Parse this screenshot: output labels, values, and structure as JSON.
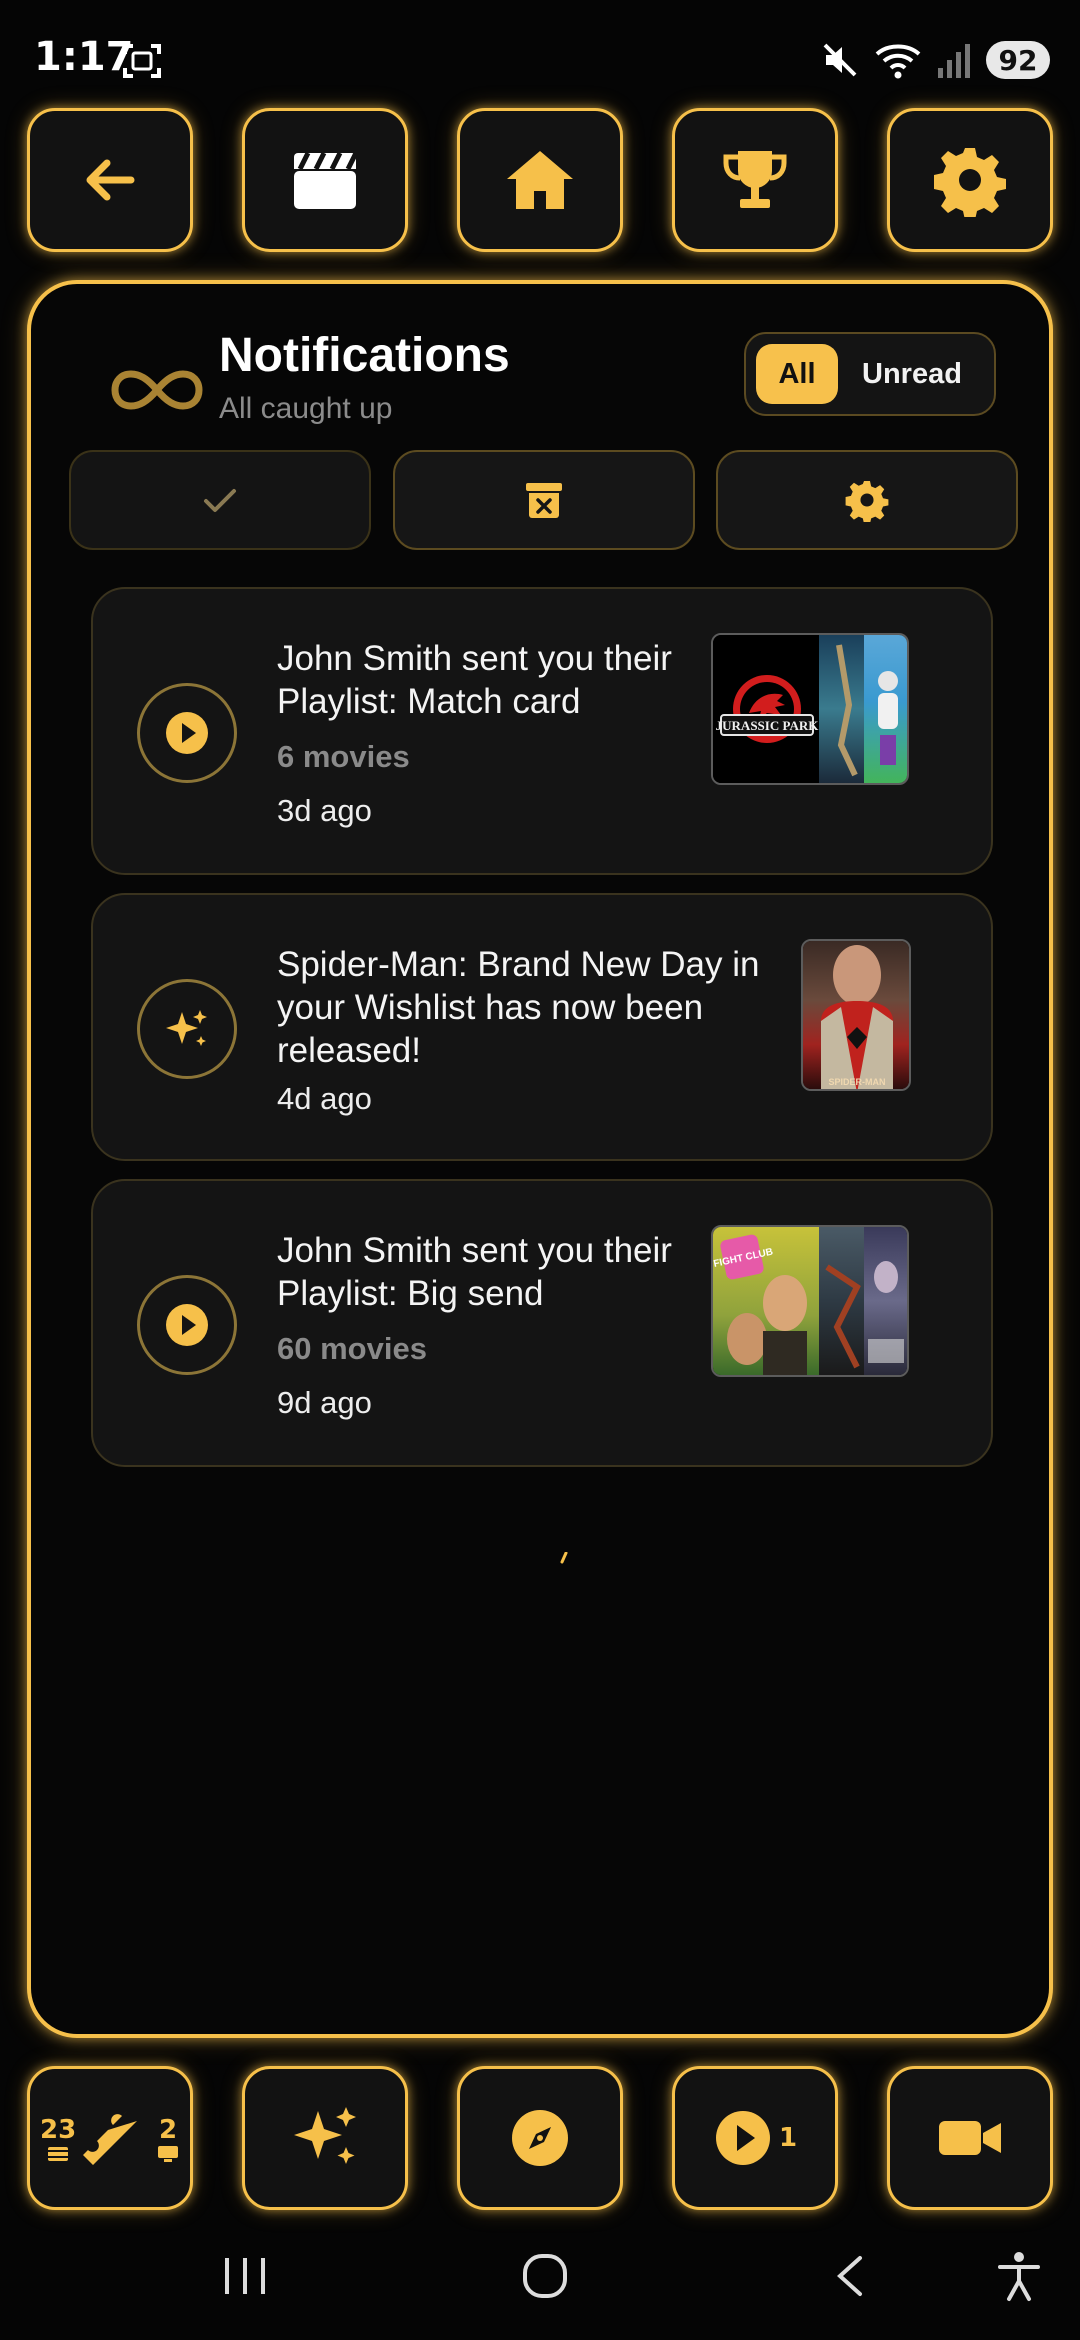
{
  "status_bar": {
    "time": "1:17",
    "battery": "92",
    "icons": [
      "screenshot-icon",
      "mute-icon",
      "wifi-icon",
      "signal-icon"
    ]
  },
  "top_nav": {
    "buttons": [
      {
        "name": "back",
        "icon": "arrow-left-icon"
      },
      {
        "name": "movies",
        "icon": "clapperboard-icon"
      },
      {
        "name": "home",
        "icon": "home-icon"
      },
      {
        "name": "trophy",
        "icon": "trophy-icon"
      },
      {
        "name": "settings",
        "icon": "gear-icon"
      }
    ]
  },
  "notifications": {
    "title": "Notifications",
    "subtitle": "All caught up",
    "filter": {
      "all": "All",
      "unread": "Unread",
      "selected": "All"
    },
    "actions": [
      "checkmark-icon",
      "archive-x-icon",
      "gear-icon"
    ],
    "items": [
      {
        "icon": "play-circle-icon",
        "title": "John Smith sent you their Playlist: Match card",
        "subtitle": "6 movies",
        "time": "3d ago",
        "poster_text": "JURASSIC PARK"
      },
      {
        "icon": "sparkles-icon",
        "title": "Spider-Man: Brand New Day in your Wishlist has now been released!",
        "time": "4d ago",
        "poster_text": "SPIDER-MAN"
      },
      {
        "icon": "play-circle-icon",
        "title": "John Smith sent you their Playlist: Big send",
        "subtitle": "60 movies",
        "time": "9d ago",
        "poster_text": "FIGHT CLUB"
      }
    ]
  },
  "bottom_nav": {
    "tickets_left": "23",
    "tickets_right": "2",
    "playlist_count": "1",
    "buttons": [
      "ticket-icon",
      "sparkles-icon",
      "compass-icon",
      "play-circle-icon",
      "video-camera-icon"
    ]
  },
  "colors": {
    "accent": "#f6c04a",
    "background": "#050505",
    "card": "#141414",
    "muted": "#8b8b8b"
  }
}
